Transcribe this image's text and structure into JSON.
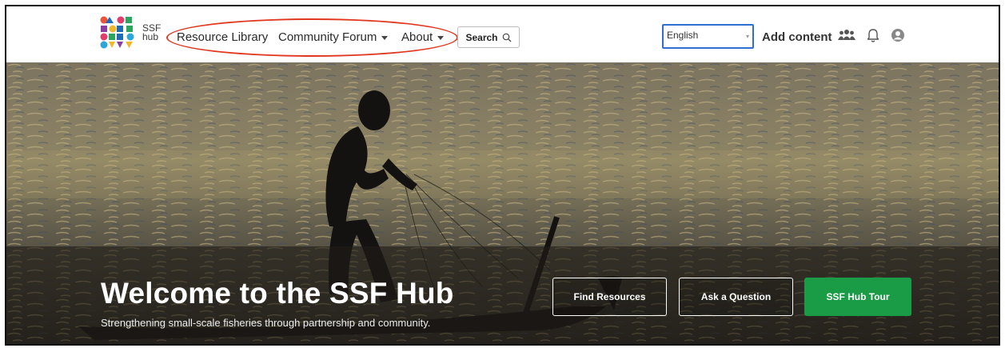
{
  "brand": {
    "line1": "SSF",
    "line2": "hub"
  },
  "nav": {
    "resource_library": "Resource Library",
    "community_forum": "Community Forum",
    "about": "About",
    "search_label": "Search"
  },
  "header_right": {
    "language": "English",
    "add_content": "Add content"
  },
  "hero": {
    "title": "Welcome to the SSF Hub",
    "subtitle": "Strengthening small-scale fisheries through partnership and community.",
    "buttons": {
      "find_resources": "Find Resources",
      "ask_question": "Ask a Question",
      "tour": "SSF Hub Tour"
    }
  },
  "colors": {
    "highlight_oval": "#e2371f",
    "tour_button": "#1a9c46",
    "language_border": "#2f6fd0"
  },
  "icons": [
    "magnifier-icon",
    "chevron-down-icon",
    "people-icon",
    "bell-icon",
    "user-circle-icon"
  ]
}
